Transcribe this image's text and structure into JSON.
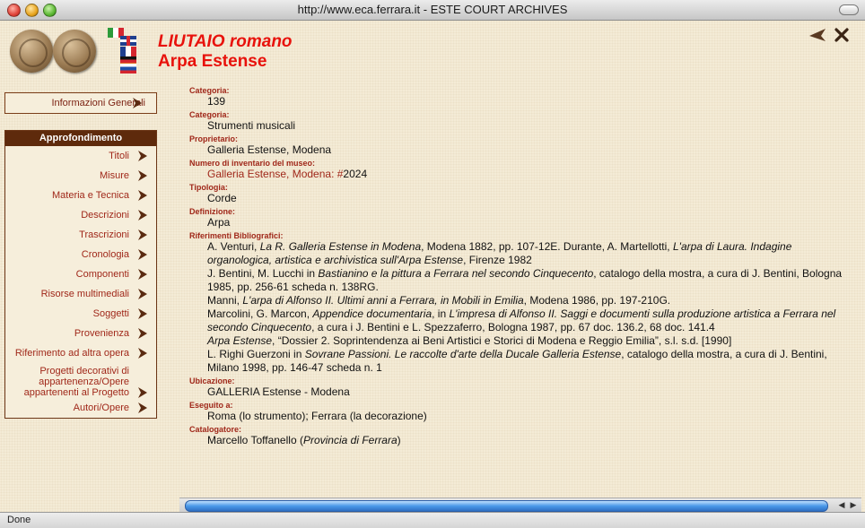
{
  "window": {
    "title": "http://www.eca.ferrara.it - ESTE COURT ARCHIVES"
  },
  "header": {
    "title_line1": "LIUTAIO romano",
    "title_line2": "Arpa Estense"
  },
  "colors": {
    "accent_red": "#e8120c",
    "label_red": "#a0281a",
    "menu_brown": "#5e2a0c",
    "page_bg": "#f4ebd6"
  },
  "sidebar": {
    "info_button": "Informazioni Generali",
    "section_title": "Approfondimento",
    "items": [
      {
        "label": "Titoli"
      },
      {
        "label": "Misure"
      },
      {
        "label": "Materia e Tecnica"
      },
      {
        "label": "Descrizioni"
      },
      {
        "label": "Trascrizioni"
      },
      {
        "label": "Cronologia"
      },
      {
        "label": "Componenti"
      },
      {
        "label": "Risorse multimediali"
      },
      {
        "label": "Soggetti"
      },
      {
        "label": "Provenienza"
      },
      {
        "label": "Riferimento ad altra opera"
      },
      {
        "label": "Progetti decorativi di appartenenza/Opere appartenenti al Progetto"
      },
      {
        "label": "Autori/Opere"
      }
    ]
  },
  "details": {
    "categoria1_label": "Categoria:",
    "categoria1_value": "139",
    "categoria2_label": "Categoria:",
    "categoria2_value": "Strumenti musicali",
    "proprietario_label": "Proprietario:",
    "proprietario_value": "Galleria Estense, Modena",
    "inventario_label": "Numero di inventario del museo:",
    "inventario_link": "Galleria Estense, Modena: #",
    "inventario_number": "2024",
    "tipologia_label": "Tipologia:",
    "tipologia_value": "Corde",
    "definizione_label": "Definizione:",
    "definizione_value": "Arpa",
    "riferimenti_label": "Riferimenti Bibliografici:",
    "ref1": {
      "a": "A. Venturi, ",
      "b": "La R. Galleria Estense in Modena",
      "c": ", Modena 1882, pp. 107-12E. Durante, A. Martellotti, ",
      "d": "L'arpa di Laura. Indagine organologica, artistica e archivistica sull'Arpa Estense",
      "e": ", Firenze 1982"
    },
    "ref2": {
      "a": "J. Bentini, M. Lucchi in ",
      "b": "Bastianino e la pittura a Ferrara nel secondo Cinquecento",
      "c": ", catalogo della mostra, a cura di J. Bentini, Bologna 1985, pp. 256-61 scheda n. 138RG."
    },
    "ref3": {
      "a": "Manni, ",
      "b": "L'arpa di Alfonso II. Ultimi anni a Ferrara, in Mobili in Emilia",
      "c": ", Modena 1986, pp. 197-210G."
    },
    "ref4": {
      "a": "Marcolini, G. Marcon, ",
      "b": "Appendice documentaria",
      "c": ", in ",
      "d": "L'impresa di Alfonso II. Saggi e documenti sulla produzione artistica a Ferrara nel secondo Cinquecento",
      "e": ", a cura i J. Bentini e L. Spezzaferro, Bologna 1987, pp. 67 doc. 136.2, 68 doc. 141.4"
    },
    "ref5": {
      "a": "Arpa Estense",
      "b": ", “Dossier 2. Soprintendenza ai Beni Artistici e Storici di Modena e Reggio Emilia”, s.l. s.d. [1990]"
    },
    "ref6": {
      "a": "L. Righi Guerzoni in ",
      "b": "Sovrane Passioni. Le raccolte d'arte della Ducale Galleria Estense",
      "c": ", catalogo della mostra, a cura di J. Bentini, Milano 1998, pp. 146-47 scheda n. 1"
    },
    "ubicazione_label": "Ubicazione:",
    "ubicazione_value": "GALLERIA Estense - Modena",
    "eseguito_label": "Eseguito a:",
    "eseguito_value": "Roma (lo strumento); Ferrara (la decorazione)",
    "catalogatore_label": "Catalogatore:",
    "catalogatore_name": "Marcello Toffanello  (",
    "catalogatore_org": "Provincia di Ferrara",
    "catalogatore_close": ")"
  },
  "status": {
    "text": "Done"
  }
}
